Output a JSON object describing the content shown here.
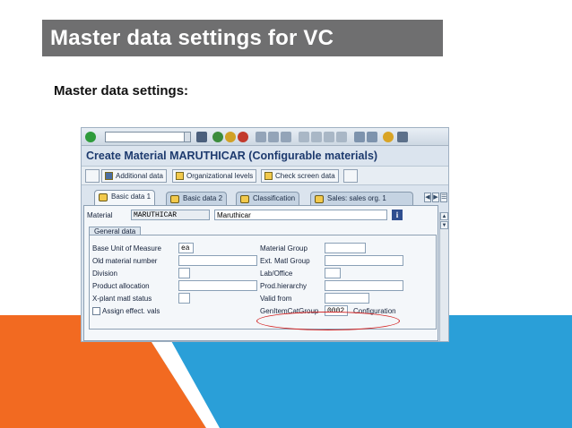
{
  "slide": {
    "title": "Master data settings for VC",
    "subtitle": "Master data settings:"
  },
  "sap": {
    "screen_title": "Create Material MARUTHICAR (Configurable materials)",
    "app_toolbar": {
      "additional_data": "Additional data",
      "org_levels": "Organizational levels",
      "check_screen_data": "Check screen data"
    },
    "tabs": [
      "Basic data 1",
      "Basic data 2",
      "Classification",
      "Sales: sales org. 1"
    ],
    "material": {
      "label": "Material",
      "value": "MARUTHICAR",
      "description": "Maruthicar"
    },
    "general_data": {
      "group_label": "General data",
      "base_uom_label": "Base Unit of Measure",
      "base_uom_value": "ea",
      "old_material_label": "Old material number",
      "division_label": "Division",
      "product_allocation_label": "Product allocation",
      "xplant_status_label": "X-plant matl status",
      "assign_effect_label": "Assign effect. vals",
      "material_group_label": "Material Group",
      "ext_matl_group_label": "Ext. Matl Group",
      "lab_office_label": "Lab/Office",
      "prod_hierarchy_label": "Prod.hierarchy",
      "valid_from_label": "Valid from",
      "gen_item_cat_label": "GenItemCatGroup",
      "gen_item_cat_value": "0002",
      "gen_item_cat_desc": "Configuration"
    }
  },
  "colors": {
    "title_bar": "#6f6f70",
    "orange": "#f26a21",
    "blue": "#2a9fd8",
    "highlight": "#d21d1d"
  }
}
